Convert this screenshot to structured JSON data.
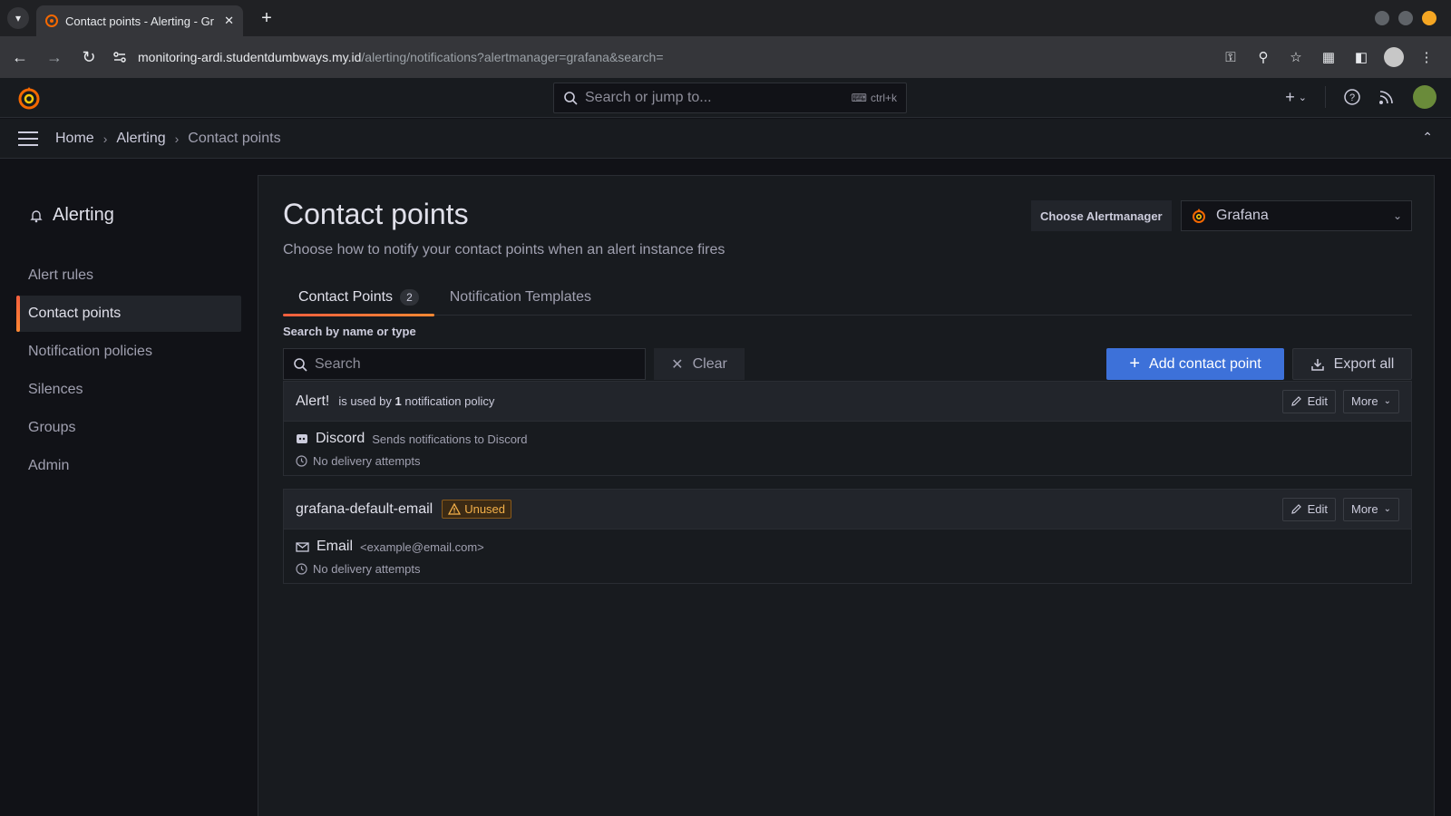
{
  "browser": {
    "tab_title": "Contact points - Alerting - Gr",
    "url_host": "monitoring-ardi.studentdumbways.my.id",
    "url_path": "/alerting/notifications?alertmanager=grafana&search="
  },
  "topbar": {
    "search_placeholder": "Search or jump to...",
    "shortcut": "ctrl+k"
  },
  "breadcrumbs": [
    "Home",
    "Alerting",
    "Contact points"
  ],
  "sidebar": {
    "title": "Alerting",
    "items": [
      {
        "label": "Alert rules"
      },
      {
        "label": "Contact points",
        "active": true
      },
      {
        "label": "Notification policies"
      },
      {
        "label": "Silences"
      },
      {
        "label": "Groups"
      },
      {
        "label": "Admin"
      }
    ]
  },
  "page": {
    "title": "Contact points",
    "subtitle": "Choose how to notify your contact points when an alert instance fires",
    "alertmanager_label": "Choose Alertmanager",
    "alertmanager_value": "Grafana"
  },
  "tabs": [
    {
      "label": "Contact Points",
      "count": "2",
      "active": true
    },
    {
      "label": "Notification Templates"
    }
  ],
  "search": {
    "label": "Search by name or type",
    "placeholder": "Search",
    "clear_label": "Clear"
  },
  "actions": {
    "add_label": "Add contact point",
    "export_label": "Export all",
    "edit_label": "Edit",
    "more_label": "More"
  },
  "contact_points": [
    {
      "name": "Alert!",
      "usage_prefix": "is used by",
      "usage_count": "1",
      "usage_suffix": "notification policy",
      "integration": "Discord",
      "description": "Sends notifications to Discord",
      "status": "No delivery attempts",
      "icon": "discord-icon"
    },
    {
      "name": "grafana-default-email",
      "badge": "Unused",
      "integration": "Email",
      "description": "<example@email.com>",
      "status": "No delivery attempts",
      "icon": "envelope-icon"
    }
  ],
  "colors": {
    "primary_button": "#3d71d9",
    "accent_gradient_start": "#f55f3e",
    "accent_gradient_end": "#ff8833",
    "warning": "#f5b14a"
  }
}
